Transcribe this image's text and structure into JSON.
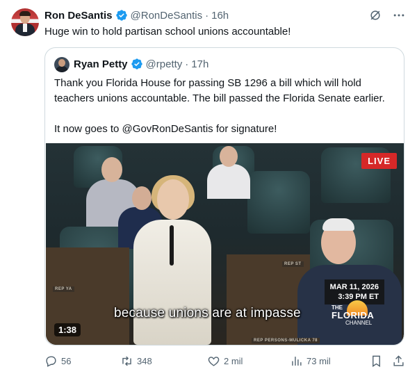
{
  "post": {
    "author_name": "Ron DeSantis",
    "author_handle": "@RonDeSantis",
    "separator": "·",
    "time": "16h",
    "text": "Huge win to hold partisan school unions accountable!",
    "top_icons": [
      "grok-icon",
      "more-icon"
    ]
  },
  "quote": {
    "author_name": "Ryan Petty",
    "author_handle": "@rpetty",
    "separator": "·",
    "time": "17h",
    "text_p1": "Thank you Florida House for passing SB 1296 a bill which will hold teachers unions accountable. The bill passed the Florida Senate earlier.",
    "text_p2": "It now goes to @GovRonDeSantis for signature!",
    "video": {
      "live_label": "LIVE",
      "date": "MAR 11, 2026",
      "time": "3:39 PM ET",
      "caption": "because unions are at impasse",
      "channel_the": "THE",
      "channel_name": "FLORIDA",
      "channel_sub": "CHANNEL",
      "placard_1": "REP PERSONS-MULICKA 78",
      "placard_2": "REP ST",
      "placard_3": "REP YA",
      "duration": "1:38"
    }
  },
  "actions": {
    "replies": "56",
    "reposts": "348",
    "likes": "2 mil",
    "views": "73 mil"
  },
  "colors": {
    "text": "#0f1419",
    "secondary": "#536471",
    "verified": "#1d9bf0",
    "border": "#cfd9de",
    "live": "#d62828"
  }
}
